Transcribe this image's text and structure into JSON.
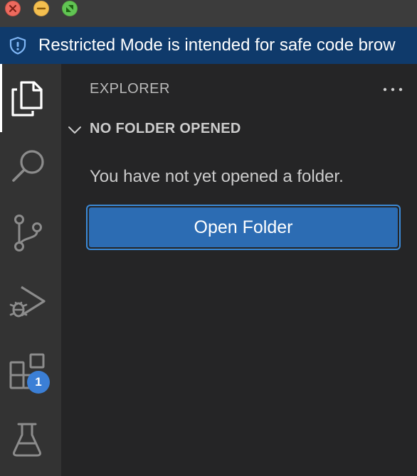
{
  "window": {
    "controls": [
      "close",
      "minimize",
      "maximize"
    ]
  },
  "banner": {
    "icon": "shield-icon",
    "text": "Restricted Mode is intended for safe code brow"
  },
  "activity_bar": {
    "items": [
      {
        "id": "explorer",
        "icon": "files-icon",
        "active": true
      },
      {
        "id": "search",
        "icon": "search-icon"
      },
      {
        "id": "source-control",
        "icon": "source-control-icon"
      },
      {
        "id": "run-debug",
        "icon": "run-debug-icon"
      },
      {
        "id": "extensions",
        "icon": "extensions-icon",
        "badge": "1"
      },
      {
        "id": "testing",
        "icon": "beaker-icon"
      }
    ]
  },
  "sidebar": {
    "title": "EXPLORER",
    "more_icon": "ellipsis-icon",
    "section": {
      "title": "NO FOLDER OPENED",
      "expanded": true
    },
    "message": "You have not yet opened a folder.",
    "button_label": "Open Folder"
  },
  "colors": {
    "banner_bg": "#0f3a6b",
    "activity_bar_bg": "#333333",
    "sidebar_bg": "#252526",
    "button_bg": "#2c6cb3",
    "badge_bg": "#3b7fd6"
  }
}
